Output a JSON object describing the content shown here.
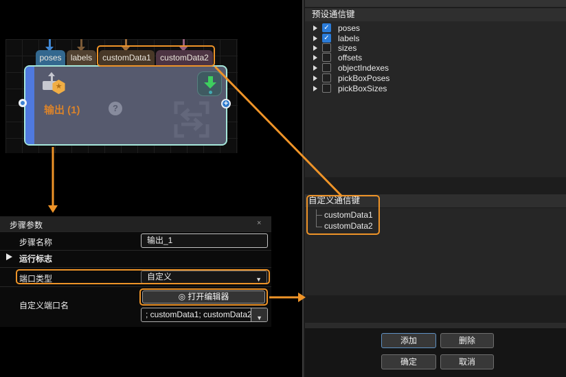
{
  "colors": {
    "annotation": "#ef9428",
    "node_border": "#a6e8db",
    "node_body": "#565a6e",
    "node_accent_bar": "#4f79de",
    "node_title": "#d9832b",
    "tab_poses": "#33688f",
    "tab_labels": "#514130",
    "tab_customData1": "#483827",
    "tab_customData2": "#4d3443",
    "checkbox_checked": "#2b7cd9",
    "focused_button_border": "#6092c4",
    "run_arrow_green": "#3ecf5f"
  },
  "icons": {
    "gear": "◎",
    "dropdown_caret": "▼",
    "check": "✓",
    "close": "×",
    "help": "?",
    "star": "★",
    "plus_port": "+"
  },
  "graph": {
    "node": {
      "title": "输出 (1)",
      "ports": [
        {
          "name": "poses"
        },
        {
          "name": "labels"
        },
        {
          "name": "customData1"
        },
        {
          "name": "customData2"
        }
      ]
    }
  },
  "step_params": {
    "title": "步骤参数",
    "step_name_label": "步骤名称",
    "step_name_value": "输出_1",
    "run_flag_section": "运行标志",
    "port_type_label": "端口类型",
    "port_type_value": "自定义",
    "custom_port_label": "自定义端口名",
    "open_editor_button": "打开编辑器",
    "custom_ports_value": "; customData1; customData2"
  },
  "key_dialog": {
    "preset_header": "预设通信键",
    "preset_items": [
      {
        "label": "poses",
        "checked": true
      },
      {
        "label": "labels",
        "checked": true
      },
      {
        "label": "sizes",
        "checked": false
      },
      {
        "label": "offsets",
        "checked": false
      },
      {
        "label": "objectIndexes",
        "checked": false
      },
      {
        "label": "pickBoxPoses",
        "checked": false
      },
      {
        "label": "pickBoxSizes",
        "checked": false
      }
    ],
    "custom_header": "自定义通信键",
    "custom_items": [
      {
        "label": "customData1"
      },
      {
        "label": "customData2"
      }
    ],
    "buttons": {
      "add": "添加",
      "delete": "删除",
      "ok": "确定",
      "cancel": "取消"
    }
  }
}
